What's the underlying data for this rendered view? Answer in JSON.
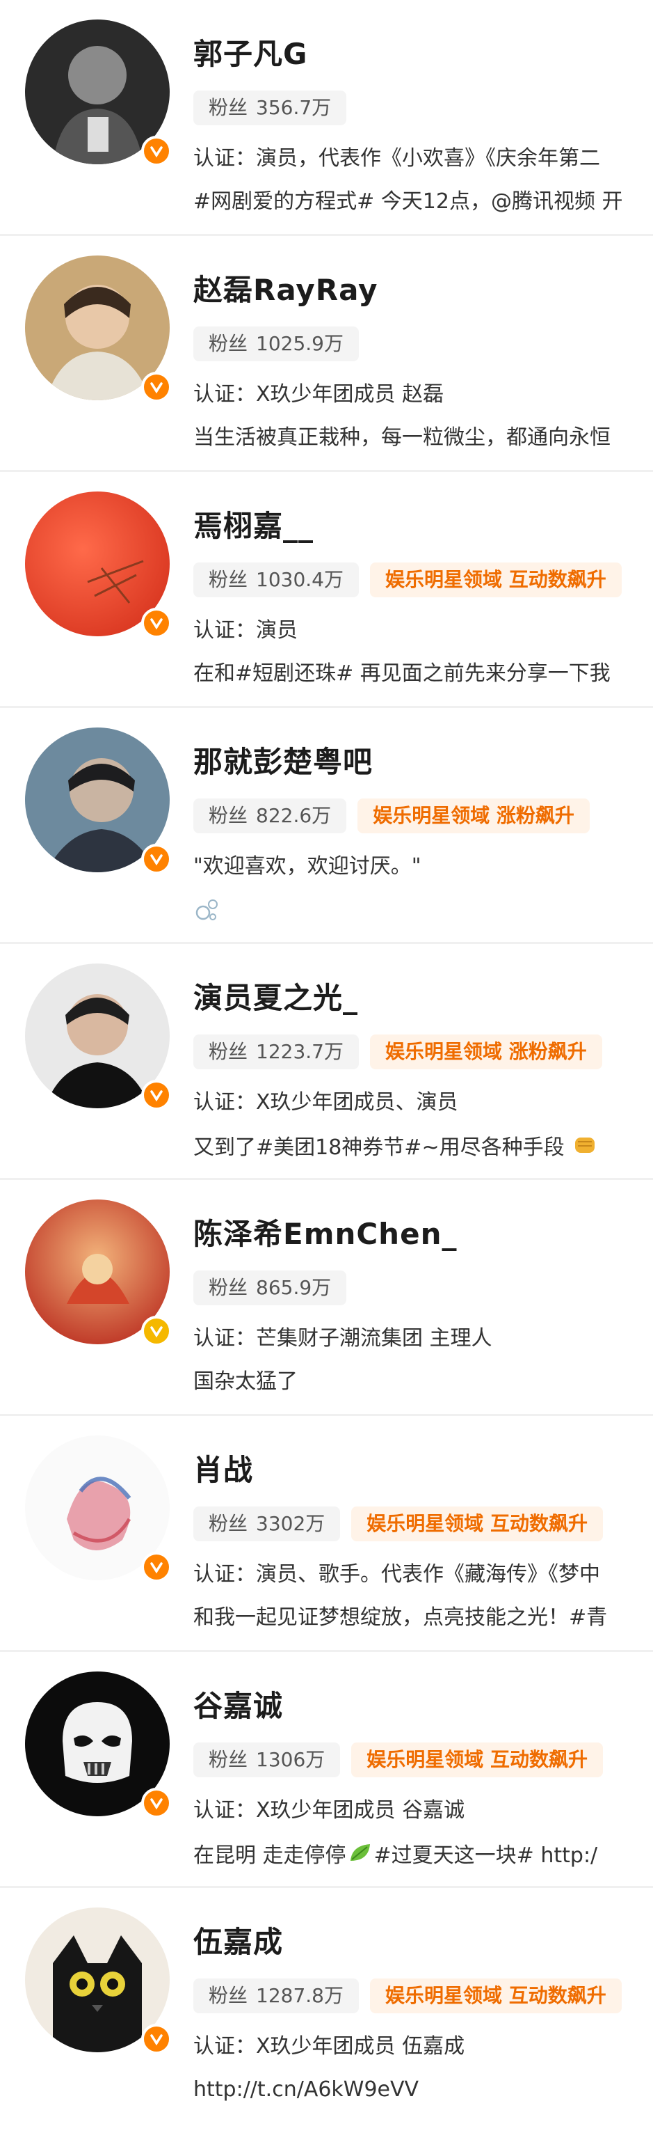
{
  "colors": {
    "accent": "#ff8200",
    "tag_bg": "#fff3e8",
    "tag_text": "#ef6c00",
    "fans_bg": "#f4f4f4"
  },
  "users": [
    {
      "name": "郭子凡G",
      "fans_label": "粉丝",
      "fans": "356.7万",
      "tag": "",
      "line1": "认证：演员，代表作《小欢喜》《庆余年第二",
      "line2": "#网剧爱的方程式# 今天12点，@腾讯视频 开"
    },
    {
      "name": "赵磊RayRay",
      "fans_label": "粉丝",
      "fans": "1025.9万",
      "tag": "",
      "line1": "认证：X玖少年团成员 赵磊",
      "line2": "当生活被真正栽种，每一粒微尘，都通向永恒"
    },
    {
      "name": "焉栩嘉__",
      "fans_label": "粉丝",
      "fans": "1030.4万",
      "tag": "娱乐明星领域 互动数飙升",
      "line1": "认证：演员",
      "line2": "在和#短剧还珠# 再见面之前先来分享一下我"
    },
    {
      "name": "那就彭楚粤吧",
      "fans_label": "粉丝",
      "fans": "822.6万",
      "tag": "娱乐明星领域 涨粉飙升",
      "line1": "\"欢迎喜欢，欢迎讨厌。\"",
      "line2": ""
    },
    {
      "name": "演员夏之光_",
      "fans_label": "粉丝",
      "fans": "1223.7万",
      "tag": "娱乐明星领域 涨粉飙升",
      "line1": "认证：X玖少年团成员、演员",
      "line2": "又到了#美团18神券节#~用尽各种手段"
    },
    {
      "name": "陈泽希EmnChen_",
      "fans_label": "粉丝",
      "fans": "865.9万",
      "tag": "",
      "line1": "认证：芒集财子潮流集团 主理人",
      "line2": "国杂太猛了"
    },
    {
      "name": "肖战",
      "fans_label": "粉丝",
      "fans": "3302万",
      "tag": "娱乐明星领域 互动数飙升",
      "line1": "认证：演员、歌手。代表作《藏海传》《梦中",
      "line2": "和我一起见证梦想绽放，点亮技能之光！#青"
    },
    {
      "name": "谷嘉诚",
      "fans_label": "粉丝",
      "fans": "1306万",
      "tag": "娱乐明星领域 互动数飙升",
      "line1": "认证：X玖少年团成员 谷嘉诚",
      "line2": "在昆明 走走停停",
      "line2b": "#过夏天这一块# http:/"
    },
    {
      "name": "伍嘉成",
      "fans_label": "粉丝",
      "fans": "1287.8万",
      "tag": "娱乐明星领域 互动数飙升",
      "line1": "认证：X玖少年团成员 伍嘉成",
      "line2": "http://t.cn/A6kW9eVV"
    }
  ]
}
